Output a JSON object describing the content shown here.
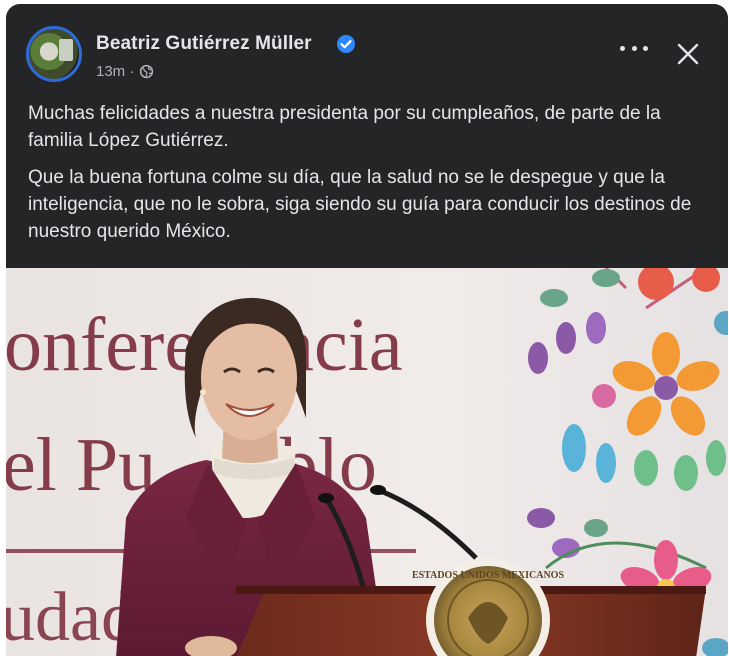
{
  "post": {
    "author": "Beatriz Gutiérrez Müller",
    "timestamp": "13m",
    "separator": "·",
    "audience_icon": "globe-icon",
    "verified_icon": "verified-badge-icon",
    "more_icon": "more-horizontal-icon",
    "close_icon": "close-icon",
    "paragraphs": [
      "Muchas felicidades a nuestra presidenta por su cumpleaños, de parte de la familia López Gutiérrez.",
      "Que la buena fortuna colme su día, que la salud no se le despegue y que la inteligencia, que no le sobra, siga siendo su guía para conducir los destinos de nuestro querido México."
    ]
  },
  "photo": {
    "backdrop_lines": [
      "onfere",
      "ncia",
      "el Pu",
      "eblo",
      "udad"
    ],
    "seal_text": "ESTADOS UNIDOS MEXICANOS"
  },
  "colors": {
    "card_bg": "#242526",
    "text_primary": "#e4e6eb",
    "text_secondary": "#b0b3b8",
    "verified_blue": "#2d88ff",
    "avatar_ring": "#2d6bd9"
  }
}
